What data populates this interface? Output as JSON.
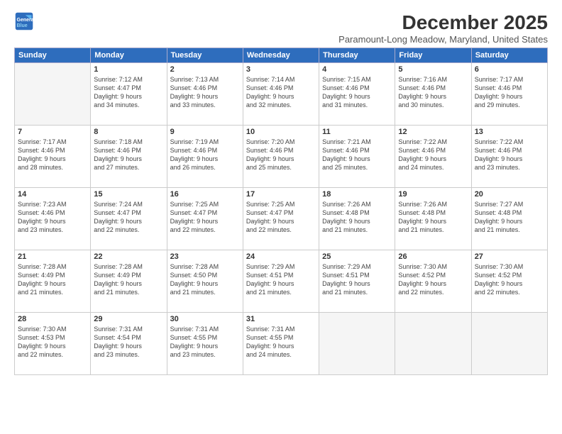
{
  "logo": {
    "line1": "General",
    "line2": "Blue"
  },
  "title": "December 2025",
  "subtitle": "Paramount-Long Meadow, Maryland, United States",
  "headers": [
    "Sunday",
    "Monday",
    "Tuesday",
    "Wednesday",
    "Thursday",
    "Friday",
    "Saturday"
  ],
  "weeks": [
    [
      {
        "day": "",
        "lines": []
      },
      {
        "day": "1",
        "lines": [
          "Sunrise: 7:12 AM",
          "Sunset: 4:47 PM",
          "Daylight: 9 hours",
          "and 34 minutes."
        ]
      },
      {
        "day": "2",
        "lines": [
          "Sunrise: 7:13 AM",
          "Sunset: 4:46 PM",
          "Daylight: 9 hours",
          "and 33 minutes."
        ]
      },
      {
        "day": "3",
        "lines": [
          "Sunrise: 7:14 AM",
          "Sunset: 4:46 PM",
          "Daylight: 9 hours",
          "and 32 minutes."
        ]
      },
      {
        "day": "4",
        "lines": [
          "Sunrise: 7:15 AM",
          "Sunset: 4:46 PM",
          "Daylight: 9 hours",
          "and 31 minutes."
        ]
      },
      {
        "day": "5",
        "lines": [
          "Sunrise: 7:16 AM",
          "Sunset: 4:46 PM",
          "Daylight: 9 hours",
          "and 30 minutes."
        ]
      },
      {
        "day": "6",
        "lines": [
          "Sunrise: 7:17 AM",
          "Sunset: 4:46 PM",
          "Daylight: 9 hours",
          "and 29 minutes."
        ]
      }
    ],
    [
      {
        "day": "7",
        "lines": [
          "Sunrise: 7:17 AM",
          "Sunset: 4:46 PM",
          "Daylight: 9 hours",
          "and 28 minutes."
        ]
      },
      {
        "day": "8",
        "lines": [
          "Sunrise: 7:18 AM",
          "Sunset: 4:46 PM",
          "Daylight: 9 hours",
          "and 27 minutes."
        ]
      },
      {
        "day": "9",
        "lines": [
          "Sunrise: 7:19 AM",
          "Sunset: 4:46 PM",
          "Daylight: 9 hours",
          "and 26 minutes."
        ]
      },
      {
        "day": "10",
        "lines": [
          "Sunrise: 7:20 AM",
          "Sunset: 4:46 PM",
          "Daylight: 9 hours",
          "and 25 minutes."
        ]
      },
      {
        "day": "11",
        "lines": [
          "Sunrise: 7:21 AM",
          "Sunset: 4:46 PM",
          "Daylight: 9 hours",
          "and 25 minutes."
        ]
      },
      {
        "day": "12",
        "lines": [
          "Sunrise: 7:22 AM",
          "Sunset: 4:46 PM",
          "Daylight: 9 hours",
          "and 24 minutes."
        ]
      },
      {
        "day": "13",
        "lines": [
          "Sunrise: 7:22 AM",
          "Sunset: 4:46 PM",
          "Daylight: 9 hours",
          "and 23 minutes."
        ]
      }
    ],
    [
      {
        "day": "14",
        "lines": [
          "Sunrise: 7:23 AM",
          "Sunset: 4:46 PM",
          "Daylight: 9 hours",
          "and 23 minutes."
        ]
      },
      {
        "day": "15",
        "lines": [
          "Sunrise: 7:24 AM",
          "Sunset: 4:47 PM",
          "Daylight: 9 hours",
          "and 22 minutes."
        ]
      },
      {
        "day": "16",
        "lines": [
          "Sunrise: 7:25 AM",
          "Sunset: 4:47 PM",
          "Daylight: 9 hours",
          "and 22 minutes."
        ]
      },
      {
        "day": "17",
        "lines": [
          "Sunrise: 7:25 AM",
          "Sunset: 4:47 PM",
          "Daylight: 9 hours",
          "and 22 minutes."
        ]
      },
      {
        "day": "18",
        "lines": [
          "Sunrise: 7:26 AM",
          "Sunset: 4:48 PM",
          "Daylight: 9 hours",
          "and 21 minutes."
        ]
      },
      {
        "day": "19",
        "lines": [
          "Sunrise: 7:26 AM",
          "Sunset: 4:48 PM",
          "Daylight: 9 hours",
          "and 21 minutes."
        ]
      },
      {
        "day": "20",
        "lines": [
          "Sunrise: 7:27 AM",
          "Sunset: 4:48 PM",
          "Daylight: 9 hours",
          "and 21 minutes."
        ]
      }
    ],
    [
      {
        "day": "21",
        "lines": [
          "Sunrise: 7:28 AM",
          "Sunset: 4:49 PM",
          "Daylight: 9 hours",
          "and 21 minutes."
        ]
      },
      {
        "day": "22",
        "lines": [
          "Sunrise: 7:28 AM",
          "Sunset: 4:49 PM",
          "Daylight: 9 hours",
          "and 21 minutes."
        ]
      },
      {
        "day": "23",
        "lines": [
          "Sunrise: 7:28 AM",
          "Sunset: 4:50 PM",
          "Daylight: 9 hours",
          "and 21 minutes."
        ]
      },
      {
        "day": "24",
        "lines": [
          "Sunrise: 7:29 AM",
          "Sunset: 4:51 PM",
          "Daylight: 9 hours",
          "and 21 minutes."
        ]
      },
      {
        "day": "25",
        "lines": [
          "Sunrise: 7:29 AM",
          "Sunset: 4:51 PM",
          "Daylight: 9 hours",
          "and 21 minutes."
        ]
      },
      {
        "day": "26",
        "lines": [
          "Sunrise: 7:30 AM",
          "Sunset: 4:52 PM",
          "Daylight: 9 hours",
          "and 22 minutes."
        ]
      },
      {
        "day": "27",
        "lines": [
          "Sunrise: 7:30 AM",
          "Sunset: 4:52 PM",
          "Daylight: 9 hours",
          "and 22 minutes."
        ]
      }
    ],
    [
      {
        "day": "28",
        "lines": [
          "Sunrise: 7:30 AM",
          "Sunset: 4:53 PM",
          "Daylight: 9 hours",
          "and 22 minutes."
        ]
      },
      {
        "day": "29",
        "lines": [
          "Sunrise: 7:31 AM",
          "Sunset: 4:54 PM",
          "Daylight: 9 hours",
          "and 23 minutes."
        ]
      },
      {
        "day": "30",
        "lines": [
          "Sunrise: 7:31 AM",
          "Sunset: 4:55 PM",
          "Daylight: 9 hours",
          "and 23 minutes."
        ]
      },
      {
        "day": "31",
        "lines": [
          "Sunrise: 7:31 AM",
          "Sunset: 4:55 PM",
          "Daylight: 9 hours",
          "and 24 minutes."
        ]
      },
      {
        "day": "",
        "lines": []
      },
      {
        "day": "",
        "lines": []
      },
      {
        "day": "",
        "lines": []
      }
    ]
  ]
}
